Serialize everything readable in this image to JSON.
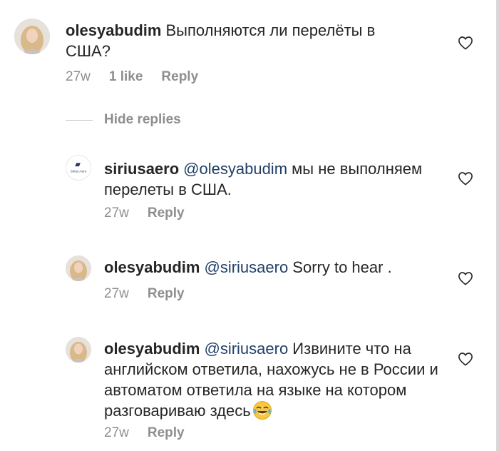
{
  "comments": [
    {
      "username": "olesyabudim",
      "text": "Выполняются ли перелёты в США?",
      "time": "27w",
      "likes": "1 like",
      "reply": "Reply",
      "avatar_icon": "woman-portrait-avatar"
    },
    {
      "username": "siriusaero",
      "mention": "@olesyabudim",
      "text": " мы не выполняем перелеты в США.",
      "time": "27w",
      "reply": "Reply",
      "avatar_icon": "sirius-aero-logo",
      "avatar_label": "Sirius Aero"
    },
    {
      "username": "olesyabudim",
      "mention": "@siriusaero",
      "text": " Sorry to hear .",
      "time": "27w",
      "reply": "Reply",
      "avatar_icon": "woman-portrait-avatar"
    },
    {
      "username": "olesyabudim",
      "mention": "@siriusaero",
      "text": " Извините что на английском ответила, нахожусь не в России и автоматом ответила на языке на котором разговариваю здесь",
      "time": "27w",
      "reply": "Reply",
      "emoji": "tears-of-joy-emoji",
      "avatar_icon": "woman-portrait-avatar"
    }
  ],
  "hide_replies": "Hide replies",
  "colors": {
    "text": "#262626",
    "muted": "#8e8e8e",
    "mention": "#1f3f68"
  }
}
